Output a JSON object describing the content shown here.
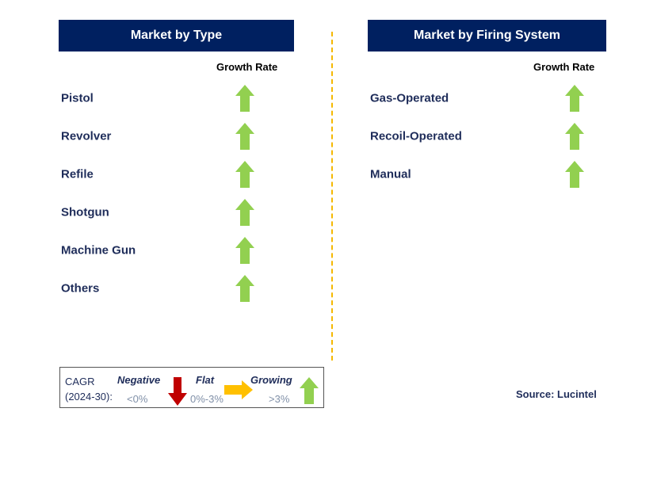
{
  "left": {
    "title": "Market by Type",
    "growth_header": "Growth Rate",
    "items": [
      {
        "label": "Pistol",
        "trend": "growing"
      },
      {
        "label": "Revolver",
        "trend": "growing"
      },
      {
        "label": "Refile",
        "trend": "growing"
      },
      {
        "label": "Shotgun",
        "trend": "growing"
      },
      {
        "label": "Machine Gun",
        "trend": "growing"
      },
      {
        "label": "Others",
        "trend": "growing"
      }
    ]
  },
  "right": {
    "title": "Market by Firing System",
    "growth_header": "Growth Rate",
    "items": [
      {
        "label": "Gas-Operated",
        "trend": "growing"
      },
      {
        "label": "Recoil-Operated",
        "trend": "growing"
      },
      {
        "label": "Manual",
        "trend": "growing"
      }
    ]
  },
  "legend": {
    "cagr": "CAGR",
    "period": "(2024-30):",
    "negative": "Negative",
    "negative_range": "<0%",
    "flat": "Flat",
    "flat_range": "0%-3%",
    "growing": "Growing",
    "growing_range": ">3%"
  },
  "source": "Source: Lucintel",
  "colors": {
    "header": "#002060",
    "growing": "#92D050",
    "flat": "#FFC000",
    "negative": "#C00000",
    "divider": "#F5B800"
  }
}
